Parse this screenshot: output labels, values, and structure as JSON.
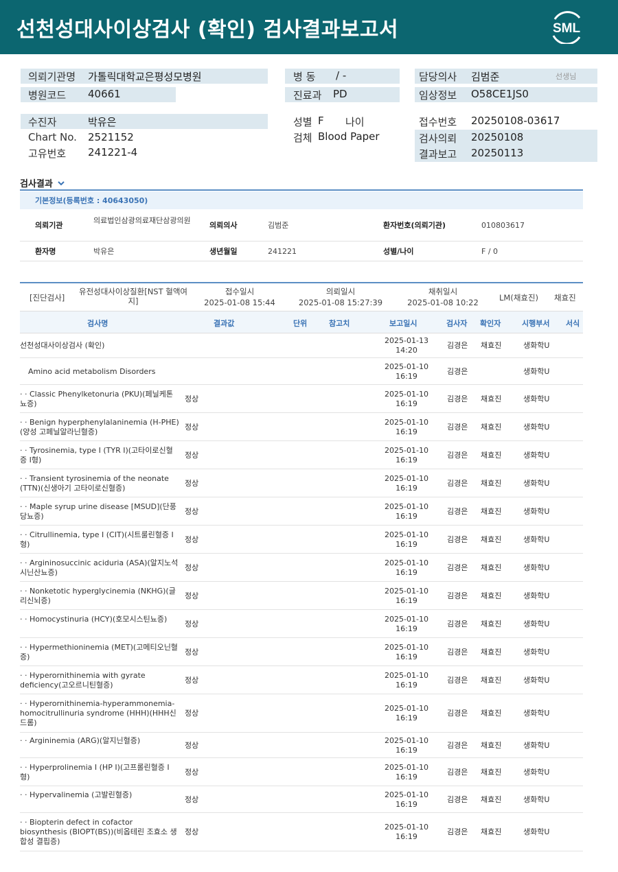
{
  "header": {
    "title": "선천성대사이상검사 (확인) 검사결과보고서",
    "logo_text": "SML",
    "color": "#0c6670"
  },
  "request": {
    "institution_label": "의뢰기관명",
    "institution_value": "가톨릭대학교은평성모병원",
    "hospital_code_label": "병원코드",
    "hospital_code_value": "40661",
    "ward_label": "병 동",
    "ward_value": "/ -",
    "dept_label": "진료과",
    "dept_value": "PD",
    "doctor_label": "담당의사",
    "doctor_value": "김범준",
    "doctor_suffix": "선생님",
    "clinical_label": "임상정보",
    "clinical_value": "O58CE1JS0",
    "patient_label": "수진자",
    "patient_value": "박유은",
    "chart_label": "Chart No.",
    "chart_value": "2521152",
    "uid_label": "고유번호",
    "uid_value": "241221-4",
    "sex_label": "성별",
    "sex_value": "F",
    "age_label": "나이",
    "age_value": "",
    "specimen_label": "검체",
    "specimen_value": "Blood Paper",
    "receipt_label": "접수번호",
    "receipt_value": "20250108-03617",
    "req_date_label": "검사의뢰",
    "req_date_value": "20250108",
    "report_label": "결과보고",
    "report_value": "20250113"
  },
  "results": {
    "title": "검사결과",
    "basic_info": "기본정보(등록번호 : 40643050)",
    "info_rows": [
      {
        "k1": "의뢰기관",
        "v1": "의료법인삼광의료재단삼광의원",
        "k2": "의뢰의사",
        "v2": "김범준",
        "k3": "환자번호(의뢰기관)",
        "v3": "010803617"
      },
      {
        "k1": "환자명",
        "v1": "박유은",
        "k2": "생년월일",
        "v2": "241221",
        "k3": "성별/나이",
        "v3": "F / 0"
      }
    ],
    "diag": {
      "type": "[진단검사]",
      "name": "유전성대사이상질환[NST 혈액여지]",
      "recv_label": "접수일시",
      "recv_value": "2025-01-08 15:44",
      "req_label": "의뢰일시",
      "req_value": "2025-01-08 15:27:39",
      "col_label": "채취일시",
      "col_value": "2025-01-08 10:22",
      "lm": "LM(채효진)",
      "lm_name": "채효진"
    },
    "headers": [
      "검사명",
      "결과값",
      "단위",
      "참고치",
      "보고일시",
      "검사자",
      "확인자",
      "시행부서",
      "서식"
    ],
    "rows": [
      {
        "name": "선천성대사이상검사 (확인)",
        "result": "",
        "date": "2025-01-13",
        "time": "14:20",
        "examiner": "김경은",
        "confirmer": "채효진",
        "dept": "생화학U"
      },
      {
        "name": "Amino acid metabolism Disorders",
        "result": "",
        "date": "2025-01-10",
        "time": "16:19",
        "examiner": "김경은",
        "confirmer": "",
        "dept": "생화학U"
      },
      {
        "name": "· · Classic Phenylketonuria (PKU)(페닐케톤뇨증)",
        "result": "정상",
        "date": "2025-01-10",
        "time": "16:19",
        "examiner": "김경은",
        "confirmer": "채효진",
        "dept": "생화학U"
      },
      {
        "name": "· · Benign hyperphenylalaninemia (H-PHE)(양성 고페닐알라닌혈증)",
        "result": "정상",
        "date": "2025-01-10",
        "time": "16:19",
        "examiner": "김경은",
        "confirmer": "채효진",
        "dept": "생화학U"
      },
      {
        "name": "· · Tyrosinemia, type I (TYR I)(고타이로신혈증 I형)",
        "result": "정상",
        "date": "2025-01-10",
        "time": "16:19",
        "examiner": "김경은",
        "confirmer": "채효진",
        "dept": "생화학U"
      },
      {
        "name": "· · Transient tyrosinemia of the neonate (TTN)(신생아기 고타이로신혈증)",
        "result": "정상",
        "date": "2025-01-10",
        "time": "16:19",
        "examiner": "김경은",
        "confirmer": "채효진",
        "dept": "생화학U"
      },
      {
        "name": "· · Maple syrup urine disease [MSUD](단풍당뇨증)",
        "result": "정상",
        "date": "2025-01-10",
        "time": "16:19",
        "examiner": "김경은",
        "confirmer": "채효진",
        "dept": "생화학U"
      },
      {
        "name": "· · Citrullinemia, type I (CIT)(시트룰린혈증 I형)",
        "result": "정상",
        "date": "2025-01-10",
        "time": "16:19",
        "examiner": "김경은",
        "confirmer": "채효진",
        "dept": "생화학U"
      },
      {
        "name": "· · Argininosuccinic aciduria (ASA)(알지노석시닌산뇨증)",
        "result": "정상",
        "date": "2025-01-10",
        "time": "16:19",
        "examiner": "김경은",
        "confirmer": "채효진",
        "dept": "생화학U"
      },
      {
        "name": "· · Nonketotic hyperglycinemia (NKHG)(글리신뇌증)",
        "result": "정상",
        "date": "2025-01-10",
        "time": "16:19",
        "examiner": "김경은",
        "confirmer": "채효진",
        "dept": "생화학U"
      },
      {
        "name": "· · Homocystinuria (HCY)(호모시스틴뇨증)",
        "result": "정상",
        "date": "2025-01-10",
        "time": "16:19",
        "examiner": "김경은",
        "confirmer": "채효진",
        "dept": "생화학U"
      },
      {
        "name": "· · Hypermethioninemia (MET)(고메티오닌혈증)",
        "result": "정상",
        "date": "2025-01-10",
        "time": "16:19",
        "examiner": "김경은",
        "confirmer": "채효진",
        "dept": "생화학U"
      },
      {
        "name": "· · Hyperornithinemia with gyrate deficiency(고오르니틴혈증)",
        "result": "정상",
        "date": "2025-01-10",
        "time": "16:19",
        "examiner": "김경은",
        "confirmer": "채효진",
        "dept": "생화학U"
      },
      {
        "name": "· · Hyperornithinemia-hyperammonemia-homocitrullinuria syndrome (HHH)(HHH신드롬)",
        "result": "정상",
        "date": "2025-01-10",
        "time": "16:19",
        "examiner": "김경은",
        "confirmer": "채효진",
        "dept": "생화학U"
      },
      {
        "name": "· · Argininemia (ARG)(알지닌혈증)",
        "result": "정상",
        "date": "2025-01-10",
        "time": "16:19",
        "examiner": "김경은",
        "confirmer": "채효진",
        "dept": "생화학U"
      },
      {
        "name": "· · Hyperprolinemia I (HP I)(고프롤린혈증 I형)",
        "result": "정상",
        "date": "2025-01-10",
        "time": "16:19",
        "examiner": "김경은",
        "confirmer": "채효진",
        "dept": "생화학U"
      },
      {
        "name": "· · Hypervalinemia (고발린혈증)",
        "result": "정상",
        "date": "2025-01-10",
        "time": "16:19",
        "examiner": "김경은",
        "confirmer": "채효진",
        "dept": "생화학U"
      },
      {
        "name": "· · Biopterin defect in cofactor biosynthesis (BIOPT(BS))(비옵테린 조효소 생합성 결핍증)",
        "result": "정상",
        "date": "2025-01-10",
        "time": "16:19",
        "examiner": "김경은",
        "confirmer": "채효진",
        "dept": "생화학U"
      }
    ]
  }
}
